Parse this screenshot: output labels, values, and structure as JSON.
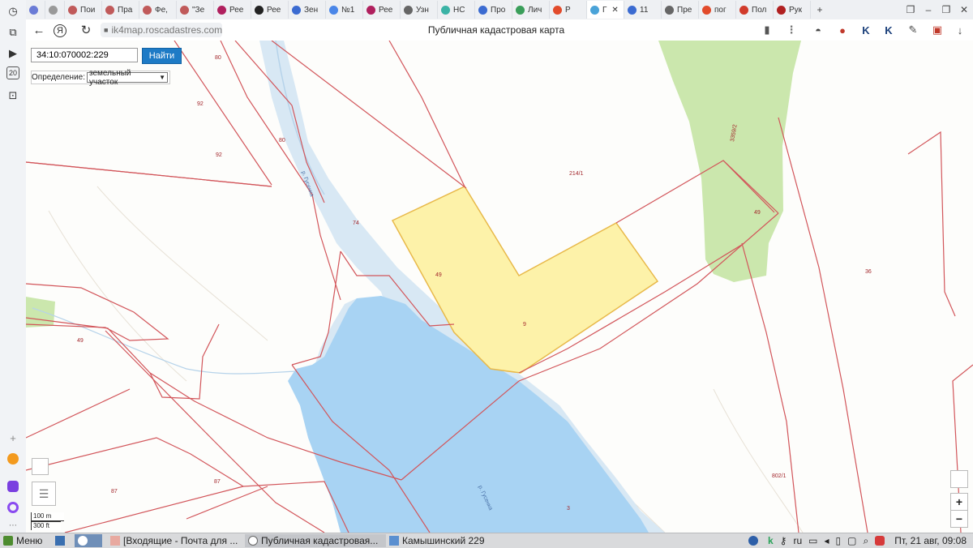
{
  "browser": {
    "tabs": [
      {
        "label": "",
        "fav": "#6a7bd6"
      },
      {
        "label": "",
        "fav": "#999"
      },
      {
        "label": "Пои",
        "fav": "#c05a5a"
      },
      {
        "label": "Пра",
        "fav": "#c05a5a"
      },
      {
        "label": "Фе,",
        "fav": "#c05a5a"
      },
      {
        "label": "\"Зе",
        "fav": "#c05a5a"
      },
      {
        "label": "Рее",
        "fav": "#b0205e"
      },
      {
        "label": "Рее",
        "fav": "#222"
      },
      {
        "label": "Зен",
        "fav": "#3b6bd1"
      },
      {
        "label": "№1",
        "fav": "#4a86e8"
      },
      {
        "label": "Рее",
        "fav": "#b0205e"
      },
      {
        "label": "Узн",
        "fav": "#666"
      },
      {
        "label": "НС",
        "fav": "#3bb3a6"
      },
      {
        "label": "Про",
        "fav": "#3b6bd1"
      },
      {
        "label": "Лич",
        "fav": "#3a9e5a"
      },
      {
        "label": "Р",
        "fav": "#e24b2b"
      },
      {
        "label": "Г",
        "fav": "#4aa3d8",
        "active": true
      },
      {
        "label": "11",
        "fav": "#3b6bd1"
      },
      {
        "label": "Пре",
        "fav": "#666"
      },
      {
        "label": "пог",
        "fav": "#e24b2b"
      },
      {
        "label": "Пол",
        "fav": "#d13b2b"
      },
      {
        "label": "Рук",
        "fav": "#b02020"
      }
    ],
    "url": "ik4map.roscadastres.com",
    "page_title": "Публичная кадастровая карта",
    "sidebar_badge": "20"
  },
  "search": {
    "value": "34:10:070002:229",
    "button_label": "Найти",
    "definition_label": "Определение:",
    "definition_value": "земельный участок"
  },
  "map": {
    "labels": {
      "p80a": "80",
      "p92a": "92",
      "p92b": "92",
      "p80b": "80",
      "p74": "74",
      "p49a": "49",
      "p9": "9",
      "p214": "214/1",
      "p49b": "49",
      "p36": "36",
      "p49c": "49",
      "p87a": "87",
      "p87b": "87",
      "p802": "802/1",
      "p3": "3",
      "p3359": "3359/2"
    },
    "river_labels": {
      "r1": "р. Гусенка",
      "r2": "р. Гусенка"
    },
    "scale": {
      "metric": "100 m",
      "imperial": "300 ft"
    },
    "zoom_in": "+",
    "zoom_out": "−"
  },
  "taskbar": {
    "menu_label": "Меню",
    "windows": [
      {
        "label": "[Входящие - Почта для ..."
      },
      {
        "label": "Публичная кадастровая..."
      },
      {
        "label": "Камышинский 229"
      }
    ],
    "lang": "ru",
    "clock": "Пт, 21 авг, 09:08"
  }
}
